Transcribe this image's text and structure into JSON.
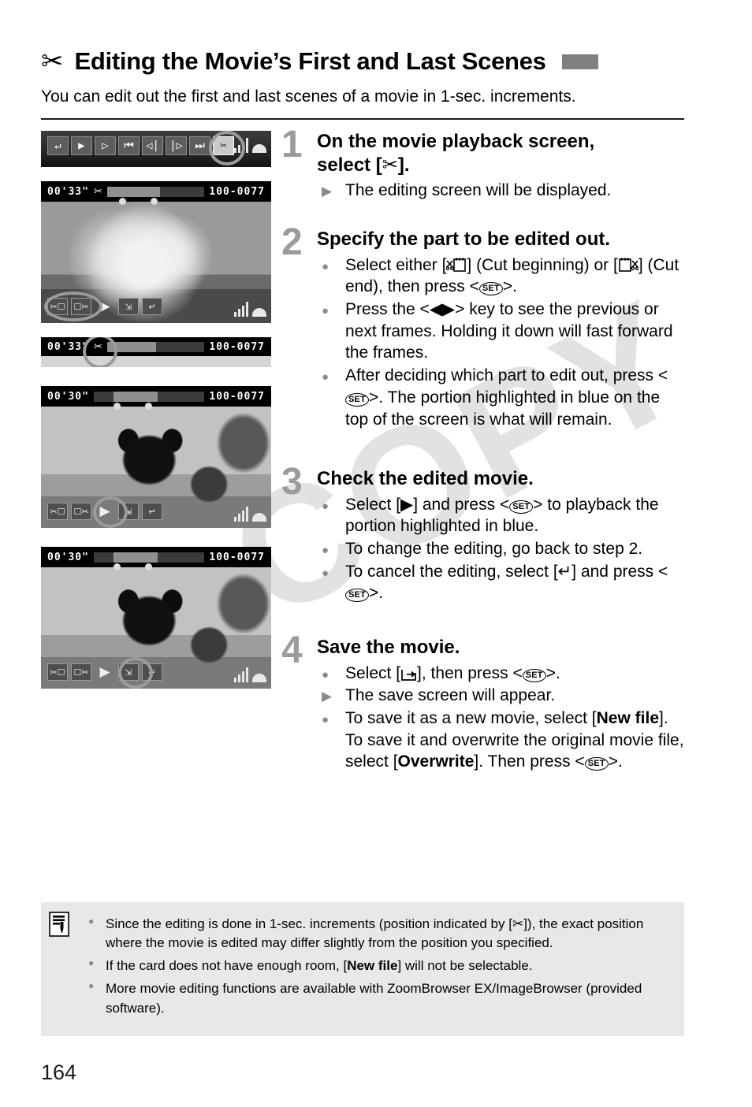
{
  "header": {
    "icon": "scissors-icon",
    "title": "Editing the Movie’s First and Last Scenes",
    "tab_marker_color": "#808080",
    "intro": "You can edit out the first and last scenes of a movie in 1-sec. increments."
  },
  "watermark": {
    "text": "COPY",
    "color": "#e2e2e2"
  },
  "figures": {
    "playback_bar": {
      "name": "movie-playback-control-bar",
      "buttons": [
        {
          "icon": "return-icon",
          "glyph": "↩",
          "selected": false
        },
        {
          "icon": "play-icon",
          "glyph": "▶",
          "selected": false
        },
        {
          "icon": "slow-motion-icon",
          "glyph": "▷",
          "selected": false
        },
        {
          "icon": "first-frame-icon",
          "glyph": "⏮",
          "selected": false
        },
        {
          "icon": "previous-frame-icon",
          "glyph": "◁",
          "selected": false
        },
        {
          "icon": "next-frame-icon",
          "glyph": "▷",
          "selected": false
        },
        {
          "icon": "last-frame-icon",
          "glyph": "⏭",
          "selected": false
        },
        {
          "icon": "scissors-edit-icon",
          "glyph": "✂",
          "selected": true
        }
      ],
      "volume_icon": "volume-bars-icon",
      "speaker_icon": "speaker-icon"
    },
    "edit_screen_flower": {
      "name": "edit-screen-flower",
      "timecode": "00'33\"",
      "scissors_marker": "scissors-icon",
      "file_number": "100-0077",
      "photo": "flower-bouquet-photo",
      "icons": [
        {
          "icon": "cut-beginning-icon",
          "selected": true
        },
        {
          "icon": "cut-end-icon",
          "selected": true
        },
        {
          "icon": "play-icon",
          "selected": false
        },
        {
          "icon": "save-icon",
          "selected": false
        },
        {
          "icon": "return-icon",
          "selected": false
        }
      ]
    },
    "timeline_detail": {
      "name": "timeline-detail-strip",
      "timecode": "00'33\"",
      "file_number": "100-0077",
      "scissors_marker": "scissors-icon"
    },
    "edit_screen_dog_play": {
      "name": "edit-screen-dog-play",
      "timecode": "00'30\"",
      "file_number": "100-0077",
      "photo": "boston-terrier-dog-photo",
      "icons": [
        {
          "icon": "cut-beginning-icon",
          "selected": false
        },
        {
          "icon": "cut-end-icon",
          "selected": false
        },
        {
          "icon": "play-icon",
          "selected": true
        },
        {
          "icon": "save-icon",
          "selected": false
        },
        {
          "icon": "return-icon",
          "selected": false
        }
      ]
    },
    "edit_screen_dog_save": {
      "name": "edit-screen-dog-save",
      "timecode": "00'30\"",
      "file_number": "100-0077",
      "photo": "boston-terrier-dog-photo",
      "icons": [
        {
          "icon": "cut-beginning-icon",
          "selected": false
        },
        {
          "icon": "cut-end-icon",
          "selected": false
        },
        {
          "icon": "play-icon",
          "selected": false
        },
        {
          "icon": "save-icon",
          "selected": true
        },
        {
          "icon": "return-icon",
          "selected": false
        }
      ]
    }
  },
  "steps": [
    {
      "number": "1",
      "heading_a": "On the movie playback screen,",
      "heading_b": "select [",
      "heading_c": "].",
      "bullets": [
        {
          "marker": "tri",
          "text": "The editing screen will be displayed."
        }
      ]
    },
    {
      "number": "2",
      "heading": "Specify the part to be edited out.",
      "bullets": [
        {
          "marker": "dot",
          "text_a": "Select either [",
          "text_b": "] (Cut beginning) or [",
          "text_c": "] (Cut end), then press <",
          "text_d": ">."
        },
        {
          "marker": "dot",
          "text_a": "Press the <",
          "text_b": "> key to see the previous or next frames. Holding it down will fast forward the frames."
        },
        {
          "marker": "dot",
          "text_a": "After deciding which part to edit out, press <",
          "text_b": ">. The portion highlighted in blue on the top of the screen is what will remain."
        }
      ]
    },
    {
      "number": "3",
      "heading": "Check the edited movie.",
      "bullets": [
        {
          "marker": "dot",
          "text_a": "Select [",
          "text_b": "] and press <",
          "text_c": "> to playback the portion highlighted in blue."
        },
        {
          "marker": "dot",
          "text_a": "To change the editing, go back to step 2."
        },
        {
          "marker": "dot",
          "text_a": "To cancel the editing, select [",
          "text_b": "] and press <",
          "text_c": ">."
        }
      ]
    },
    {
      "number": "4",
      "heading": "Save the movie.",
      "bullets": [
        {
          "marker": "dot",
          "text_a": "Select [",
          "text_b": "], then press <",
          "text_c": ">."
        },
        {
          "marker": "tri",
          "text_a": "The save screen will appear."
        },
        {
          "marker": "dot",
          "text_a": "To save it as a new movie, select [",
          "bold_a": "New file",
          "text_b": "]. To save it and overwrite the original movie file, select [",
          "bold_b": "Overwrite",
          "text_c": "]. Then press <",
          "text_d": ">."
        }
      ]
    }
  ],
  "note": {
    "icon": "memo-note-icon",
    "bullets": [
      {
        "text_a": "Since the editing is done in 1-sec. increments (position indicated by [",
        "text_b": "]), the exact position where the movie is edited may differ slightly from the position you specified."
      },
      {
        "text_a": "If the card does not have enough room, [",
        "bold_a": "New file",
        "text_b": "] will not be selectable."
      },
      {
        "text_a": "More movie editing functions are available with ZoomBrowser EX/ImageBrowser (provided software)."
      }
    ]
  },
  "page_number": "164",
  "glyphs": {
    "set_key": "SET",
    "scissors": "✂",
    "play": "▶",
    "return": "↩",
    "left_right": "◀▶"
  }
}
